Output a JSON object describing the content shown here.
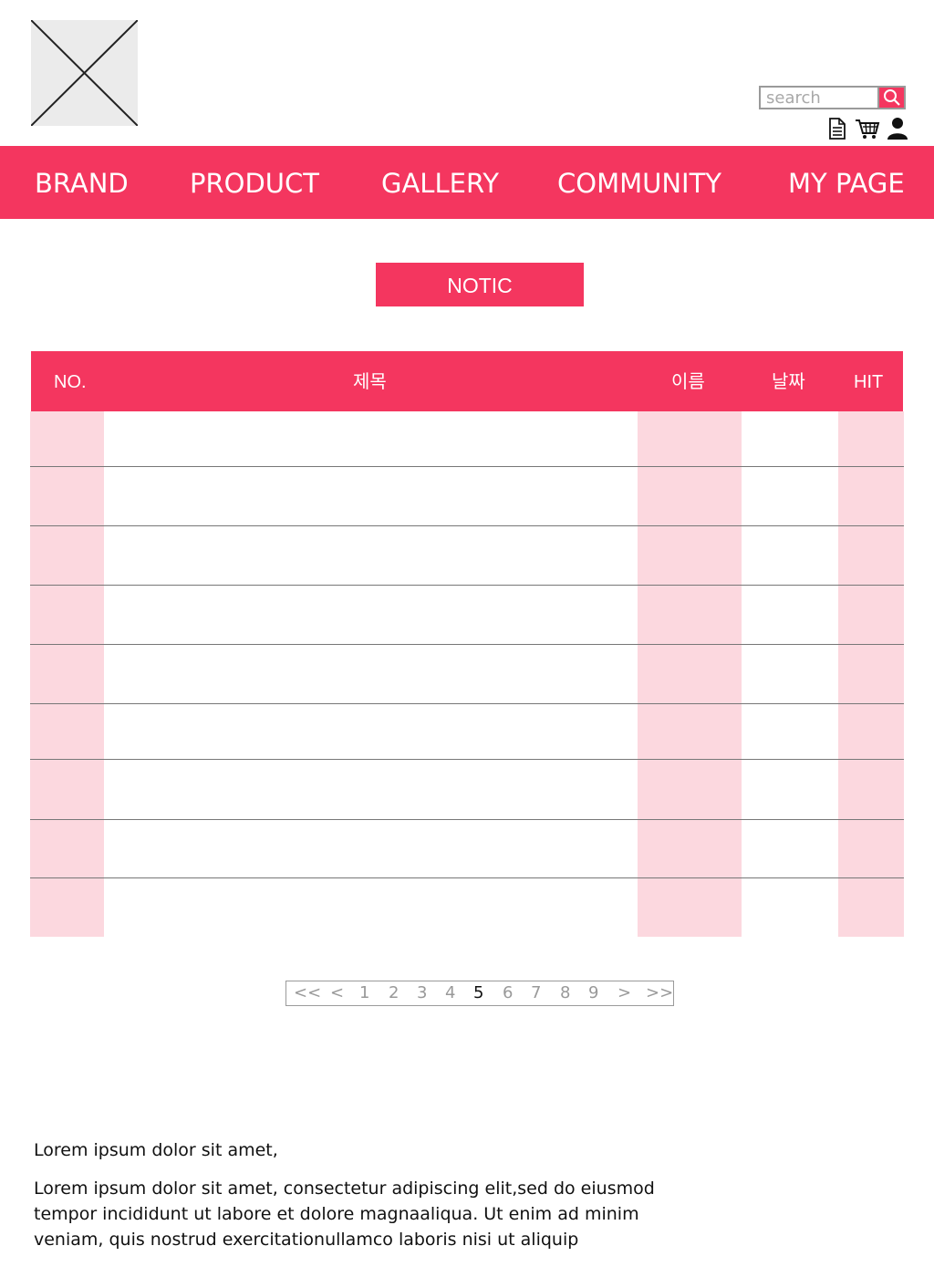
{
  "header": {
    "search": {
      "placeholder": "search"
    },
    "icons": [
      "document-icon",
      "cart-icon",
      "user-icon"
    ]
  },
  "nav": {
    "items": [
      "BRAND",
      "PRODUCT",
      "GALLERY",
      "COMMUNITY",
      "MY PAGE"
    ]
  },
  "notice": {
    "title": "NOTIC"
  },
  "board": {
    "columns": [
      "NO.",
      "제목",
      "이름",
      "날짜",
      "HIT"
    ],
    "row_count": 9
  },
  "pagination": {
    "first": "<<",
    "prev": "<",
    "pages": [
      "1",
      "2",
      "3",
      "4",
      "5",
      "6",
      "7",
      "8",
      "9"
    ],
    "current": "5",
    "next": ">",
    "last": ">>"
  },
  "footer": {
    "line1": "Lorem ipsum dolor sit amet,",
    "line2": "Lorem ipsum dolor sit amet, consectetur adipiscing elit,sed do eiusmod",
    "line3": "tempor incididunt ut labore et dolore magnaaliqua. Ut enim ad minim",
    "line4": "veniam, quis nostrud exercitationullamco laboris nisi ut aliquip"
  },
  "colors": {
    "accent": "#f4365f",
    "stripe": "#fcd8df"
  }
}
